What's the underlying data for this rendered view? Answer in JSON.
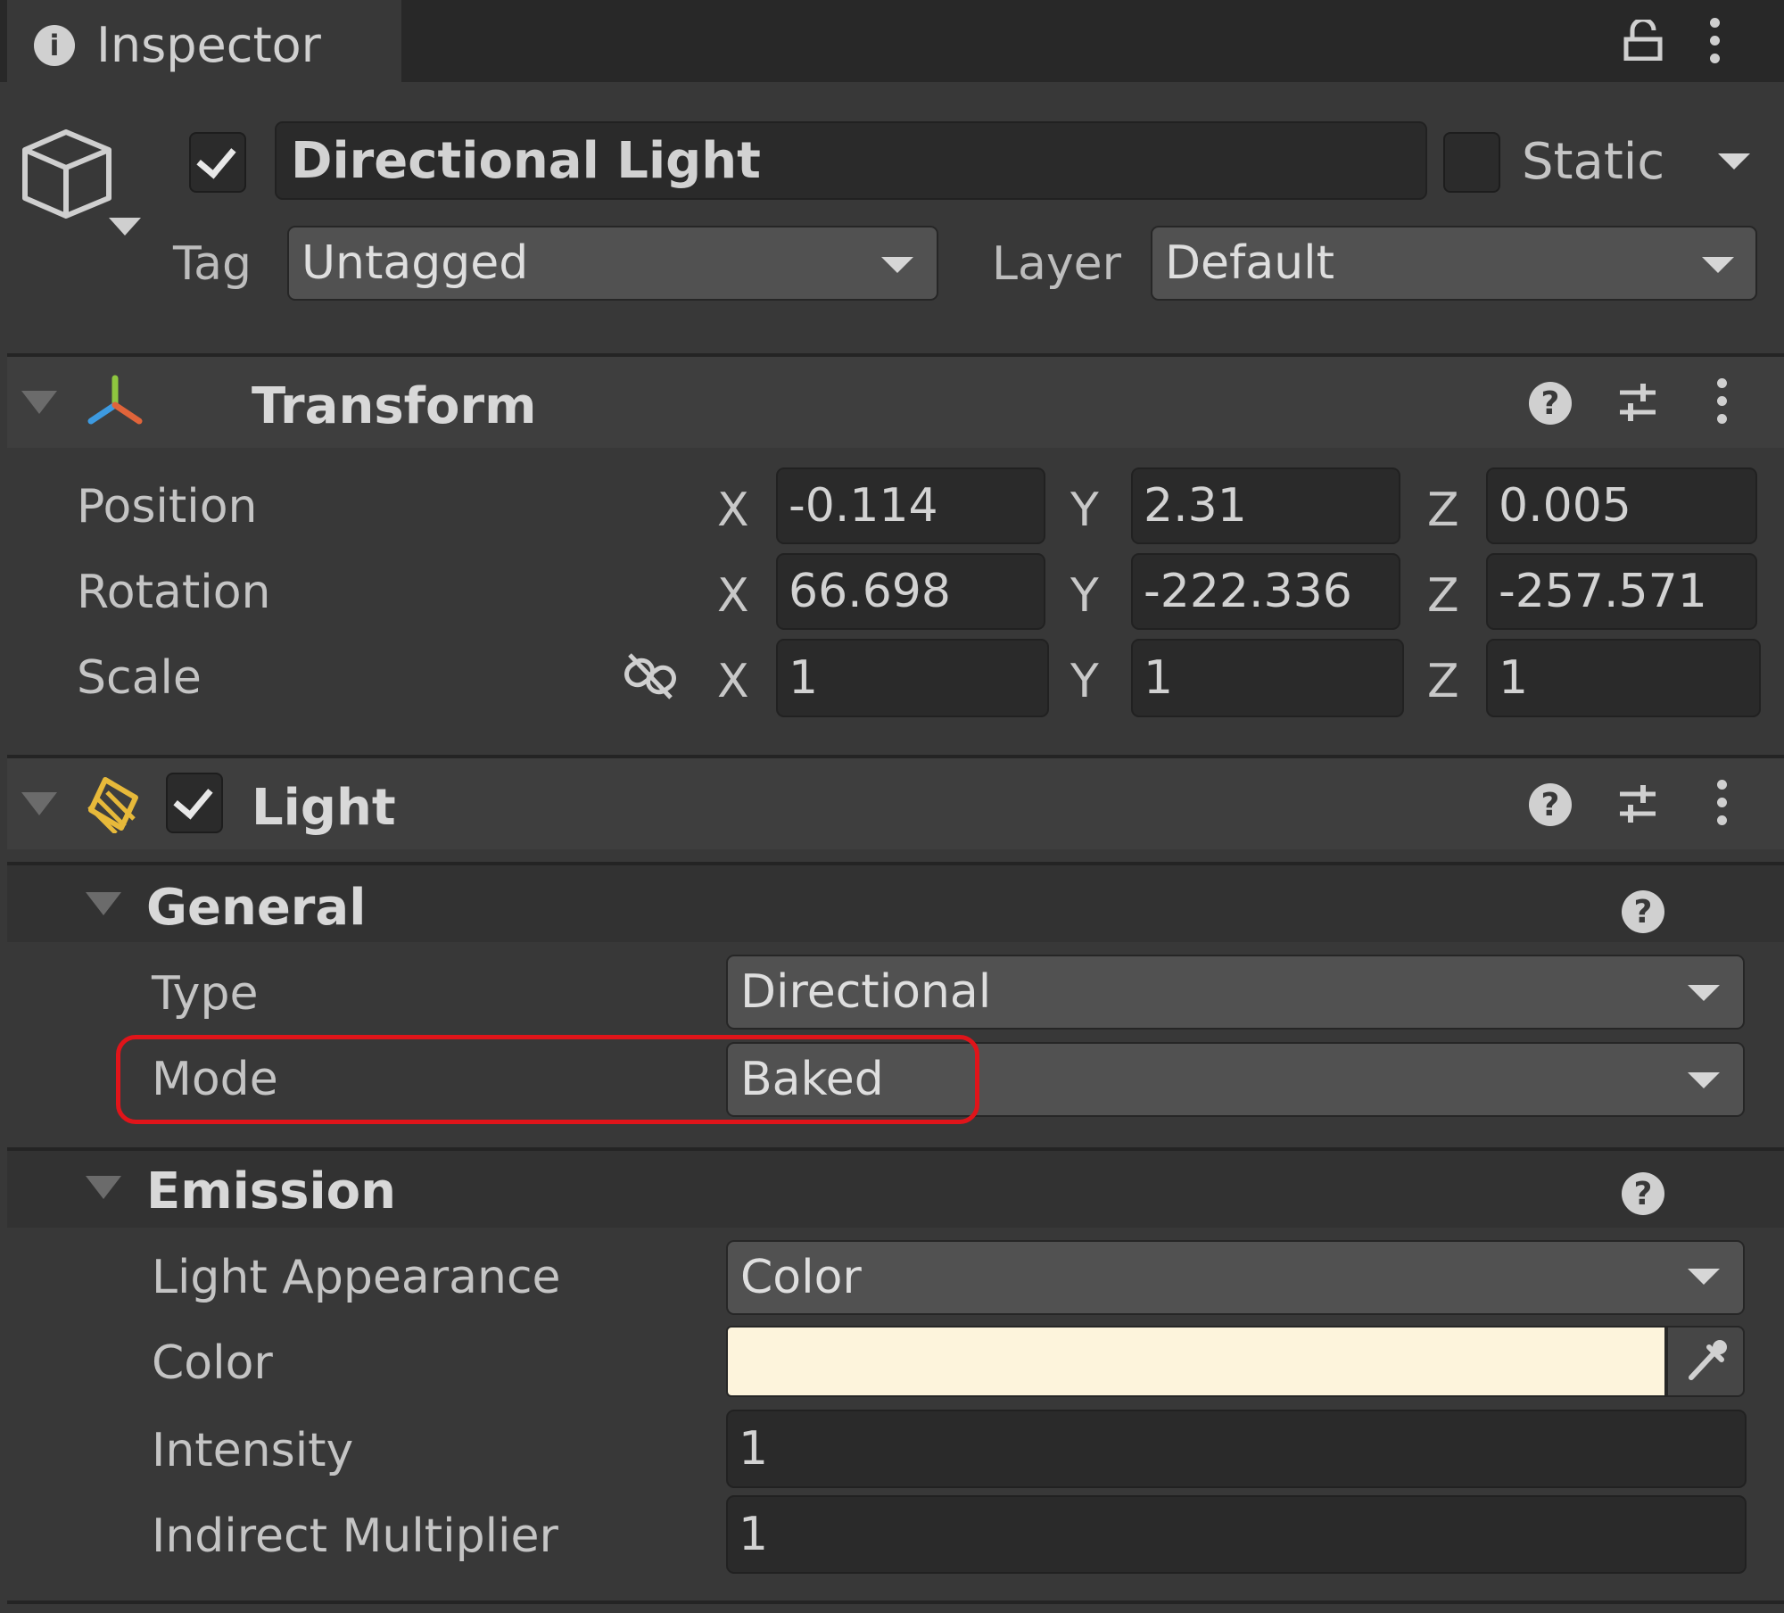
{
  "tab": {
    "title": "Inspector"
  },
  "object": {
    "name": "Directional Light",
    "active": true,
    "static_label": "Static",
    "static_checked": false
  },
  "tag": {
    "label": "Tag",
    "value": "Untagged"
  },
  "layer": {
    "label": "Layer",
    "value": "Default"
  },
  "transform": {
    "title": "Transform",
    "rows": [
      {
        "label": "Position",
        "x": "-0.114",
        "y": "2.31",
        "z": "0.005"
      },
      {
        "label": "Rotation",
        "x": "66.698",
        "y": "-222.336",
        "z": "-257.571"
      },
      {
        "label": "Scale",
        "x": "1",
        "y": "1",
        "z": "1"
      }
    ],
    "axis_labels": {
      "x": "X",
      "y": "Y",
      "z": "Z"
    }
  },
  "light": {
    "title": "Light",
    "enabled": true,
    "general": {
      "title": "General",
      "type_label": "Type",
      "type_value": "Directional",
      "mode_label": "Mode",
      "mode_value": "Baked"
    },
    "emission": {
      "title": "Emission",
      "appearance_label": "Light Appearance",
      "appearance_value": "Color",
      "color_label": "Color",
      "color_value": "#fdf4dc",
      "intensity_label": "Intensity",
      "intensity_value": "1",
      "indirect_label": "Indirect Multiplier",
      "indirect_value": "1"
    }
  },
  "colors": {
    "background": "#383838",
    "highlight": "#e0141a",
    "tab_bar": "#282828"
  }
}
